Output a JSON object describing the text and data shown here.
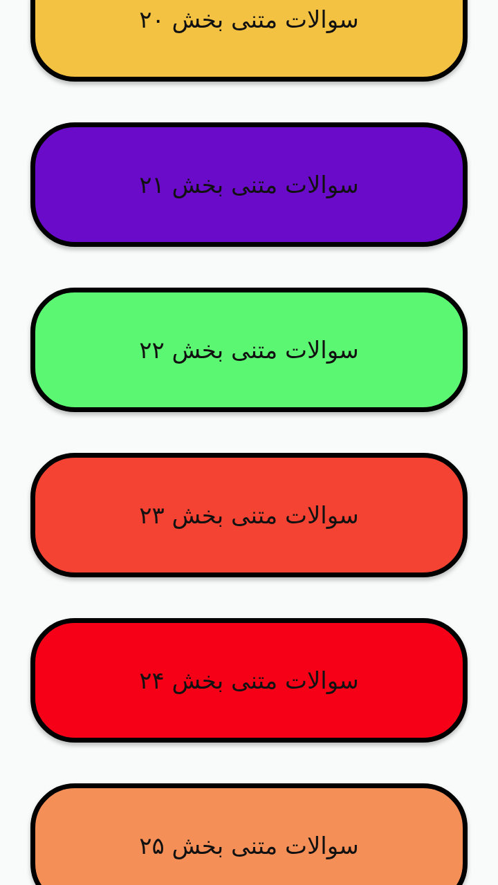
{
  "sections": [
    {
      "label": "سوالات متنی بخش ۲۰",
      "color": "#f4c242"
    },
    {
      "label": "سوالات متنی بخش ۲۱",
      "color": "#6a0bc9"
    },
    {
      "label": "سوالات متنی بخش ۲۲",
      "color": "#5cf772"
    },
    {
      "label": "سوالات متنی بخش ۲۳",
      "color": "#f44333"
    },
    {
      "label": "سوالات متنی بخش ۲۴",
      "color": "#f60018"
    },
    {
      "label": "سوالات متنی بخش ۲۵",
      "color": "#f48f58"
    }
  ]
}
